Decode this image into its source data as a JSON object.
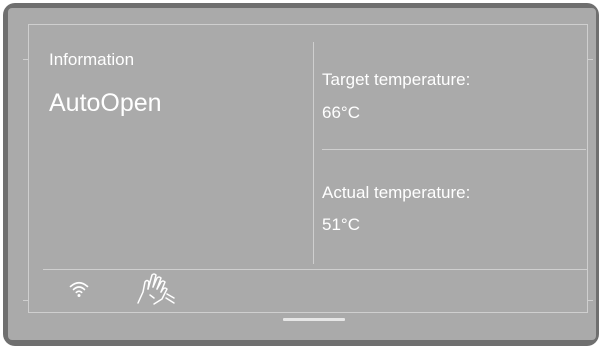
{
  "info_panel": {
    "heading": "Information",
    "program": "AutoOpen"
  },
  "target_temp": {
    "label": "Target temperature:",
    "value": "66°C"
  },
  "actual_temp": {
    "label": "Actual temperature:",
    "value": "51°C"
  },
  "status_bar": {
    "icons": [
      "wifi-icon",
      "touch-control-icon"
    ]
  },
  "colors": {
    "bezel": "#6f6f6f",
    "screen": "#aaaaaa",
    "text": "#ffffff",
    "lines": "#cfcfcf"
  }
}
